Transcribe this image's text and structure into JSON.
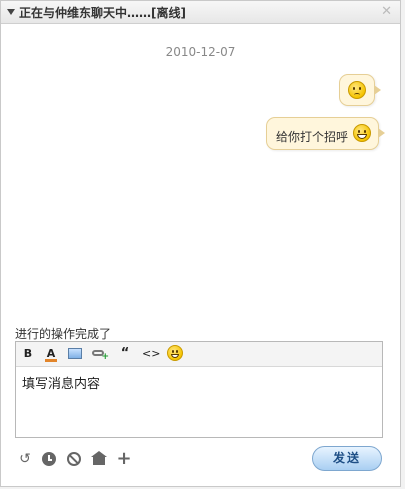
{
  "window": {
    "title": "正在与仲维东聊天中……[离线]"
  },
  "chat": {
    "date": "2010-12-07",
    "messages": [
      {
        "text": "",
        "emoticon": "sad-face-icon"
      },
      {
        "text": "给你打个招呼",
        "emoticon": "grin-face-icon"
      }
    ]
  },
  "status": {
    "text": "进行的操作完成了"
  },
  "editor": {
    "toolbar": {
      "bold_label": "B",
      "color_label": "A",
      "quote_label": "“",
      "code_label": "<>"
    },
    "value": "填写消息内容",
    "accent_color": "#e2852b"
  },
  "bottom_icons": [
    "undo-icon",
    "history-icon",
    "block-icon",
    "home-icon",
    "add-icon"
  ],
  "send": {
    "label": "发送"
  }
}
